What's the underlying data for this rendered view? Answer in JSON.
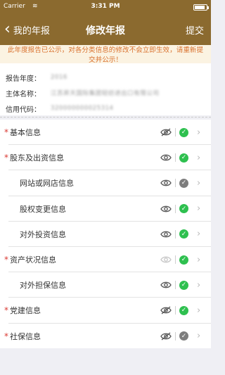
{
  "status_bar": {
    "carrier": "Carrier",
    "time": "3:31 PM",
    "battery_level": 0.9
  },
  "nav": {
    "back_label": "我的年报",
    "title": "修改年报",
    "submit_label": "提交"
  },
  "notice": "此年度报告已公示，对各分类信息的修改不会立即生效，请重新提交并公示！",
  "info": [
    {
      "label": "报告年度：",
      "value": "2016"
    },
    {
      "label": "主体名称：",
      "value": "江苏昇天国际集团轻纺进出口有限公司"
    },
    {
      "label": "信用代码：",
      "value": "320000000025314"
    }
  ],
  "items": [
    {
      "label": "基本信息",
      "required": true,
      "indent": false,
      "visibility": "hidden",
      "status": "complete"
    },
    {
      "label": "股东及出资信息",
      "required": true,
      "indent": false,
      "visibility": "visible",
      "status": "complete"
    },
    {
      "label": "网站或网店信息",
      "required": false,
      "indent": true,
      "visibility": "visible",
      "status": "incomplete"
    },
    {
      "label": "股权变更信息",
      "required": false,
      "indent": true,
      "visibility": "visible",
      "status": "complete"
    },
    {
      "label": "对外投资信息",
      "required": false,
      "indent": true,
      "visibility": "visible",
      "status": "complete"
    },
    {
      "label": "资产状况信息",
      "required": true,
      "indent": false,
      "visibility": "visible-faded",
      "status": "complete"
    },
    {
      "label": "对外担保信息",
      "required": false,
      "indent": true,
      "visibility": "visible",
      "status": "complete"
    },
    {
      "label": "党建信息",
      "required": true,
      "indent": false,
      "visibility": "hidden",
      "status": "complete"
    },
    {
      "label": "社保信息",
      "required": true,
      "indent": false,
      "visibility": "hidden",
      "status": "incomplete"
    }
  ],
  "colors": {
    "brand": "#8b6a2f",
    "notice_text": "#d9722f",
    "required": "#d93a34",
    "complete": "#2ec04f",
    "incomplete": "#7d7d7d"
  },
  "icons": {
    "back": "chevron-left-icon",
    "visible": "eye-icon",
    "hidden": "eye-slash-icon",
    "status": "check-circle-icon",
    "row": "chevron-right-icon"
  }
}
